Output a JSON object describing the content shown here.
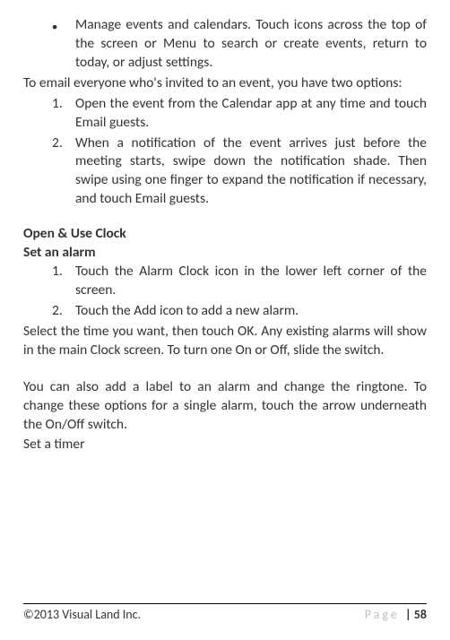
{
  "bullet1": "Manage events and calendars. Touch icons across the top of the screen or  Menu to search or create events, return to today, or adjust settings.",
  "intro": "To email everyone who's invited to an event, you have two options:",
  "steps_a": {
    "s1": "Open the event from the Calendar app at any time and touch Email guests.",
    "s2": "When a notification of the event arrives just before the meeting starts, swipe down the notification shade. Then swipe using one finger to expand the notification if necessary, and touch Email guests."
  },
  "heading": "Open & Use Clock",
  "subheading": "Set an alarm",
  "steps_b": {
    "s1": "Touch the Alarm Clock icon in the lower left corner of the screen.",
    "s2": "Touch the Add icon to add a new alarm."
  },
  "para1": "Select the time you want, then touch OK. Any existing alarms will show in the main Clock screen. To turn one On or Off, slide the switch.",
  "para2": "You can also add a label to an alarm and change the ringtone. To change these options for a single alarm, touch the arrow underneath the On/Off switch.",
  "para3": "Set a timer",
  "footer": {
    "copyright": "©2013 Visual Land Inc.",
    "page_label": "Page ",
    "page_sep": "| ",
    "page_num": "58"
  }
}
